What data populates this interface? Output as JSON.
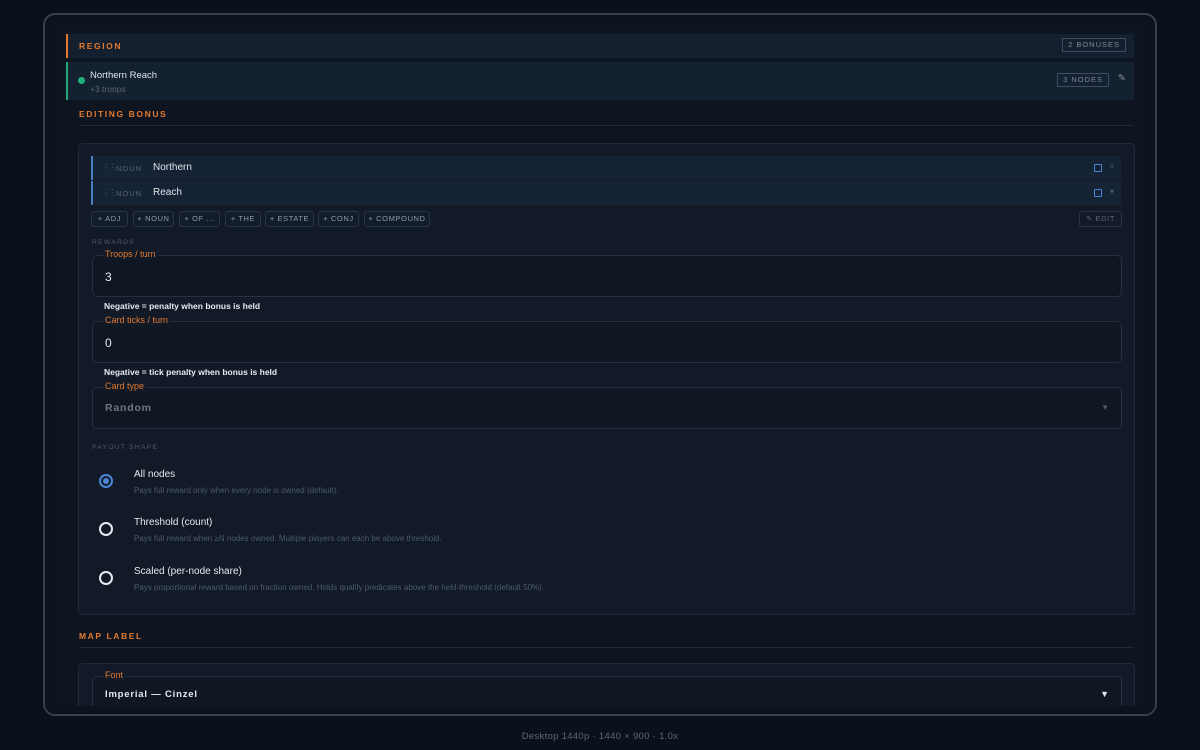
{
  "region_bar": {
    "label": "REGION",
    "bonuses": "2 BONUSES"
  },
  "region_row": {
    "name": "Northern Reach",
    "sub": "+3 troops",
    "nodes": "3 NODES",
    "edit_icon": "pencil-icon"
  },
  "editing": {
    "label": "EDITING BONUS",
    "tokens": [
      {
        "pos": "NOUN",
        "word": "Northern",
        "action": "×"
      },
      {
        "pos": "NOUN",
        "word": "Reach",
        "action": "▾"
      }
    ],
    "chips": [
      "+ ADJ",
      "+ NOUN",
      "+ OF ...",
      "+ THE",
      "+ ESTATE",
      "+ CONJ",
      "+ COMPOUND"
    ],
    "edit_chip": "EDIT",
    "rewards_label": "REWARDS",
    "troops": {
      "label": "Troops / turn",
      "value": "3",
      "hint": "Negative = penalty when bonus is held"
    },
    "card_ticks": {
      "label": "Card ticks / turn",
      "value": "0",
      "hint": "Negative = tick penalty when bonus is held"
    },
    "card_type": {
      "label": "Card type",
      "value": "Random"
    },
    "payout_label": "PAYOUT SHAPE",
    "payout_options": [
      {
        "title": "All nodes",
        "desc": "Pays full reward only when every node is owned (default).",
        "selected": true
      },
      {
        "title": "Threshold (count)",
        "desc": "Pays full reward when ≥N nodes owned. Multiple players can each be above threshold.",
        "selected": false
      },
      {
        "title": "Scaled (per-node share)",
        "desc": "Pays proportional reward based on fraction owned. Holds qualify predicates above the held-threshold (default 50%).",
        "selected": false
      }
    ]
  },
  "map_label": {
    "label": "MAP LABEL",
    "font": {
      "label": "Font",
      "value": "Imperial — Cinzel"
    }
  },
  "caption": "Desktop 1440p · 1440 × 900 · 1.0x",
  "colors": {
    "accent": "#e47a2e",
    "region_bar": "#22a778",
    "selected": "#4a86d8",
    "background": "#0e1520"
  }
}
